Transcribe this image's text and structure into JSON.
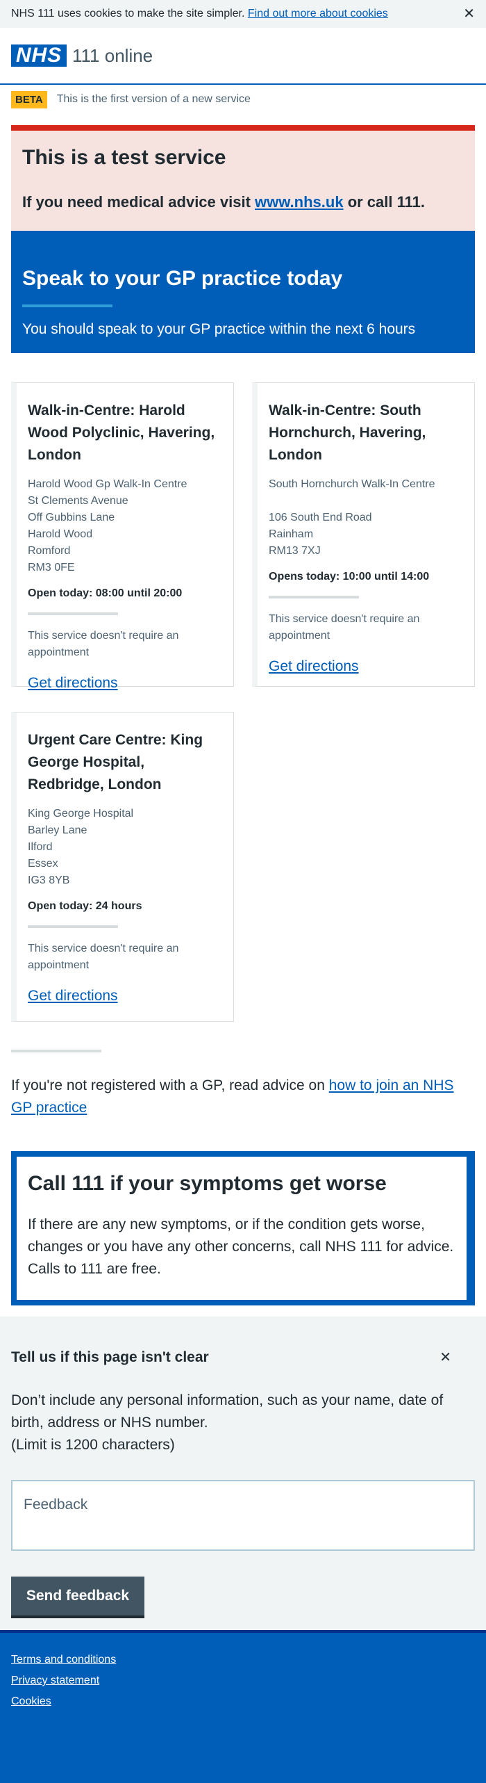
{
  "cookie_banner": {
    "text": "NHS 111 uses cookies to make the site simpler.",
    "link": "Find out more about cookies",
    "close": "✕"
  },
  "header": {
    "logo": "NHS",
    "service_name": "111 online"
  },
  "beta": {
    "tag": "BETA",
    "text": "This is the first version of a new service"
  },
  "test_notice": {
    "title": "This is a test service",
    "text_before": "If you need medical advice visit",
    "link": "www.nhs.uk",
    "text_after": "or call 111."
  },
  "hero": {
    "title": "Speak to your GP practice today",
    "subtitle": "You should speak to your GP practice within the next 6 hours"
  },
  "services": [
    {
      "title": "Walk-in-Centre: Harold Wood Polyclinic, Havering, London",
      "address": [
        "Harold Wood Gp Walk-In Centre",
        "St Clements Avenue",
        "Off Gubbins Lane",
        "Harold Wood",
        "Romford",
        "RM3 0FE"
      ],
      "opening": "Open today: 08:00 until 20:00",
      "note": "This service doesn't require an appointment",
      "link": "Get directions"
    },
    {
      "title": "Walk-in-Centre: South Hornchurch, Havering, London",
      "address": [
        "South Hornchurch Walk-In Centre",
        "",
        "106 South End Road",
        "Rainham",
        "RM13 7XJ"
      ],
      "opening": "Opens today: 10:00 until 14:00",
      "note": "This service doesn't require an appointment",
      "link": "Get directions"
    },
    {
      "title": "Urgent Care Centre: King George Hospital, Redbridge, London",
      "address": [
        "King George Hospital",
        "Barley Lane",
        "Ilford",
        "Essex",
        "IG3 8YB"
      ],
      "opening": "Open today: 24 hours",
      "note": "This service doesn't require an appointment",
      "link": "Get directions"
    }
  ],
  "gp_advice": {
    "text": "If you're not registered with a GP, read advice on",
    "link": "how to join an NHS GP practice"
  },
  "call_box": {
    "title": "Call 111 if your symptoms get worse",
    "text": "If there are any new symptoms, or if the condition gets worse, changes or you have any other concerns, call NHS 111 for advice. Calls to 111 are free."
  },
  "feedback": {
    "title": "Tell us if this page isn't clear",
    "close": "✕",
    "text": "Don’t include any personal information, such as your name, date of birth, address or NHS number.",
    "limit": "(Limit is 1200 characters)",
    "placeholder": "Feedback",
    "button": "Send feedback"
  },
  "footer": {
    "links": [
      "Terms and conditions",
      "Privacy statement",
      "Cookies"
    ]
  },
  "colors": {
    "nhs_blue": "#005eb8",
    "test_red": "#d5281b",
    "beta_yellow": "#ffb81c"
  }
}
